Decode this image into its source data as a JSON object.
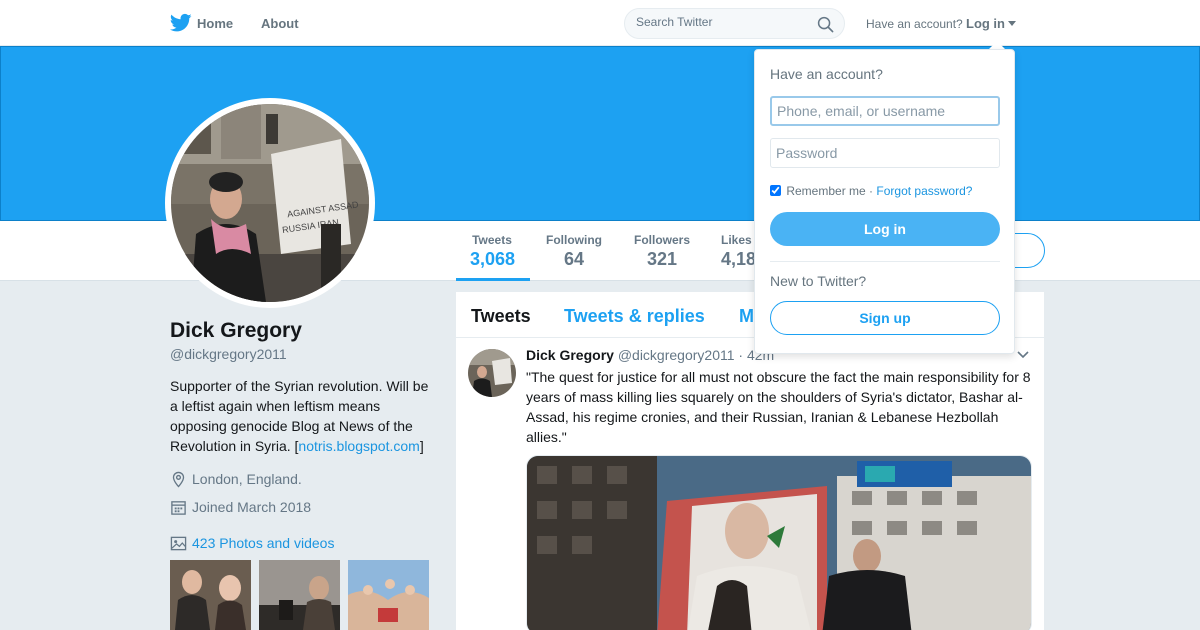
{
  "nav": {
    "home_label": "Home",
    "about_label": "About",
    "search_placeholder": "Search Twitter",
    "have_account": "Have an account?",
    "login_label": "Log in"
  },
  "stats": [
    {
      "label": "Tweets",
      "value": "3,068"
    },
    {
      "label": "Following",
      "value": "64"
    },
    {
      "label": "Followers",
      "value": "321"
    },
    {
      "label": "Likes",
      "value": "4,18"
    }
  ],
  "profile": {
    "name": "Dick Gregory",
    "handle": "@dickgregory2011",
    "bio": "Supporter of the Syrian revolution. Will be a leftist again when leftism means opposing genocide Blog at News of the Revolution in Syria. [",
    "bio_link": "notris.blogspot.com",
    "bio_end": "]",
    "location": "London, England.",
    "joined": "Joined March 2018",
    "photos_label": "423 Photos and videos"
  },
  "timeline": {
    "tabs": [
      "Tweets",
      "Tweets & replies",
      "M"
    ]
  },
  "tweet": {
    "name": "Dick Gregory",
    "handle": "@dickgregory2011",
    "time": "· 42m",
    "text": "\"The quest for justice for all must not obscure the fact the main responsibility for 8 years of mass killing lies squarely on the shoulders of Syria's dictator, Bashar al-Assad, his regime cronies, and their Russian, Iranian & Lebanese Hezbollah allies.\""
  },
  "login_dropdown": {
    "title": "Have an account?",
    "username_placeholder": "Phone, email, or username",
    "password_placeholder": "Password",
    "remember_label": "Remember me",
    "separator": "·",
    "forgot_label": "Forgot password?",
    "login_button": "Log in",
    "new_label": "New to Twitter?",
    "signup_button": "Sign up"
  },
  "colors": {
    "brand": "#1da1f2",
    "link": "#1b95e0",
    "background": "#e6ecf0"
  }
}
